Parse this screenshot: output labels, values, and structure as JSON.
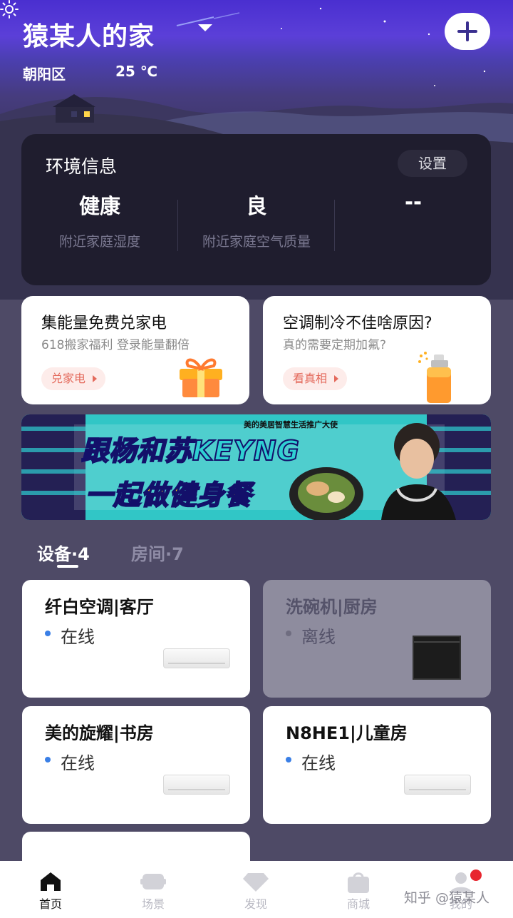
{
  "header": {
    "home_title": "猿某人的家",
    "location": "朝阳区",
    "temperature": "25 ℃",
    "weather_icon": "sun-icon",
    "add_icon": "plus-icon"
  },
  "environment": {
    "title": "环境信息",
    "settings_label": "设置",
    "metrics": [
      {
        "value": "健康",
        "label": "附近家庭湿度"
      },
      {
        "value": "良",
        "label": "附近家庭空气质量"
      },
      {
        "value": "--",
        "label": ""
      }
    ]
  },
  "promos": [
    {
      "title": "集能量免费兑家电",
      "subtitle": "618搬家福利  登录能量翻倍",
      "button": "兑家电",
      "icon": "gift-icon"
    },
    {
      "title": "空调制冷不佳啥原因?",
      "subtitle": "真的需要定期加氟?",
      "button": "看真相",
      "icon": "spray-can-icon"
    }
  ],
  "banner": {
    "tag": "美的美居智慧生活推广大使",
    "line1": "跟杨和苏KEYNG",
    "line2": "一起做健身餐"
  },
  "section_tabs": {
    "devices": "设备·4",
    "rooms": "房间·7"
  },
  "devices": [
    {
      "name": "纤白空调|客厅",
      "status": "在线",
      "online": true,
      "image": "air-conditioner"
    },
    {
      "name": "洗碗机|厨房",
      "status": "离线",
      "online": false,
      "image": "dishwasher"
    },
    {
      "name": "美的旋耀|书房",
      "status": "在线",
      "online": true,
      "image": "air-conditioner"
    },
    {
      "name": "N8HE1|儿童房",
      "status": "在线",
      "online": true,
      "image": "air-conditioner"
    }
  ],
  "bottom_nav": [
    {
      "label": "首页",
      "icon": "home-icon",
      "active": true
    },
    {
      "label": "场景",
      "icon": "scene-icon",
      "active": false
    },
    {
      "label": "发现",
      "icon": "discover-icon",
      "active": false
    },
    {
      "label": "商城",
      "icon": "shop-bag-icon",
      "active": false
    },
    {
      "label": "我的",
      "icon": "profile-icon",
      "active": false,
      "badge": true
    }
  ],
  "watermark": "知乎 @猿某人"
}
